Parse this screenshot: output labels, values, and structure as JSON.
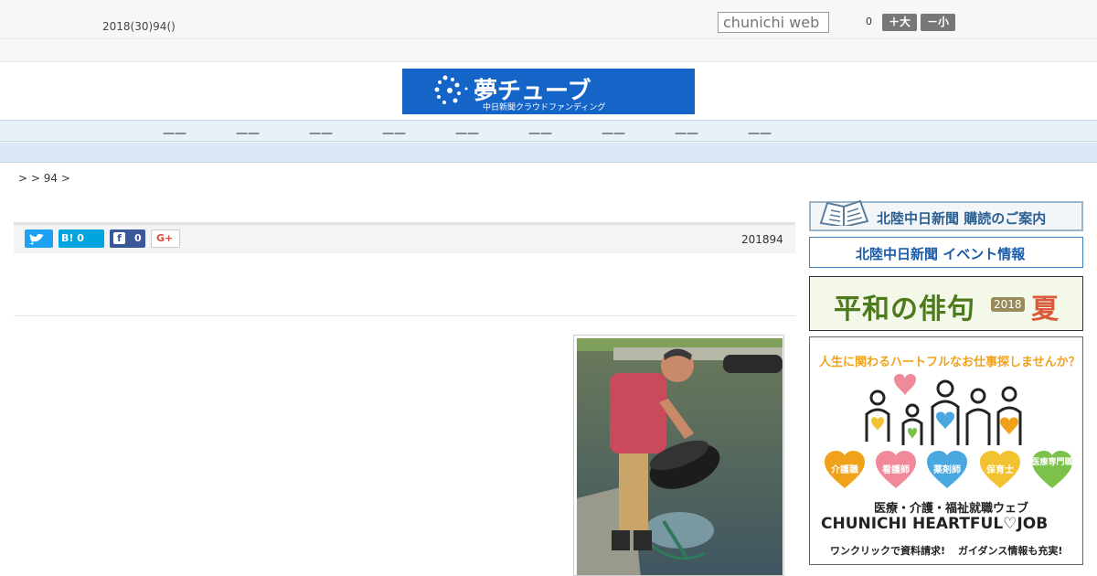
{
  "topbar": {
    "date": "2018(30)94()",
    "search_placeholder": "chunichi web",
    "font_count": "0",
    "font_big_label": "＋大",
    "font_small_label": "－小"
  },
  "logo": {
    "title": "夢チューブ",
    "subtitle": "中日新聞クラウドファンディング"
  },
  "nav": {
    "items": [
      "一一",
      "一一",
      "一一",
      "一一",
      "一一",
      "一一",
      "一一",
      "一一",
      "一一"
    ]
  },
  "breadcrumb": ">  > 94 >",
  "share": {
    "twitter_icon": "twitter-icon",
    "hatena_label": "B! 0",
    "facebook_count": "0",
    "gplus_label": "G+",
    "date": "201894"
  },
  "sidebar": {
    "subscribe_label": "北陸中日新聞 購読のご案内",
    "event_label": "北陸中日新聞 イベント情報",
    "haiku_label": "平和の俳句",
    "haiku_year": "2018",
    "haiku_season": "夏",
    "job_headline": "人生に関わるハートフルなお仕事探しませんか？",
    "job_hearts": [
      "介護職",
      "看護師",
      "薬剤師",
      "保育士",
      "医療専門職"
    ],
    "job_subtitle": "医療・介護・福祉就職ウェブ",
    "job_brand": "CHUNICHI HEARTFUL♡JOB",
    "job_note1": "ワンクリックで資料請求!",
    "job_note2": "ガイダンス情報も充実!"
  },
  "colors": {
    "accent_blue": "#1565c8",
    "nav_bg": "#e8f0f8",
    "heart_orange": "#f0a21a",
    "heart_pink": "#f08a9a",
    "heart_blue": "#4aa8e0",
    "heart_yellow": "#f2c230",
    "heart_green": "#7cc24a"
  }
}
